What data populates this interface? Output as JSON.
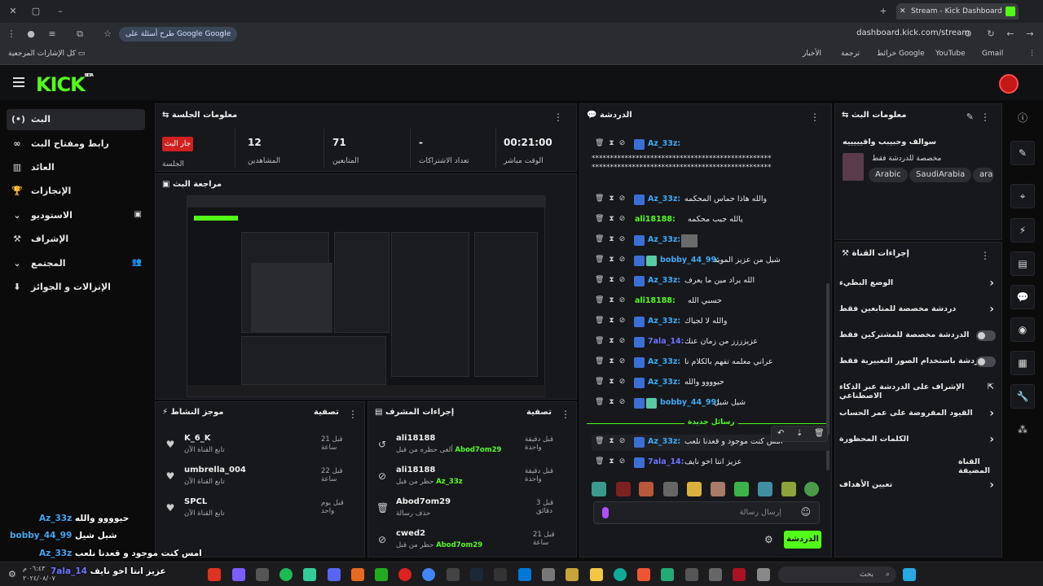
{
  "browser": {
    "tab_title": "Stream - Kick Dashboard",
    "url": "dashboard.kick.com/stream",
    "search_pill": "طرح أسئلة على Google",
    "bookmarks_all": "كل الإشارات المرجعية",
    "bookmarks": [
      "Gmail",
      "YouTube",
      "خرائط Google",
      "ترجمة",
      "الأخبار"
    ]
  },
  "header": {
    "logo": "KICK",
    "logo_sup": "BETA"
  },
  "sidebar": {
    "items": [
      {
        "label": "البث",
        "icon": "(•)"
      },
      {
        "label": "رابط ومفتاح البث",
        "icon": "∞"
      },
      {
        "label": "العائد",
        "icon": "▥"
      },
      {
        "label": "الإنجازات",
        "icon": "🏆"
      },
      {
        "label": "الاستوديو",
        "icon": "▣"
      },
      {
        "label": "الإشراف",
        "icon": "⚒"
      },
      {
        "label": "المجتمع",
        "icon": "👥"
      },
      {
        "label": "الإنزالات و الجوائز",
        "icon": "⬇"
      }
    ]
  },
  "session": {
    "title": "معلومات الجلسة",
    "live_badge": "جار البث",
    "session_label": "الجلسة",
    "stats": [
      {
        "value": "12",
        "label": "المشاهدين"
      },
      {
        "value": "71",
        "label": "المتابعين"
      },
      {
        "value": "-",
        "label": "تعداد الاشتراكات"
      },
      {
        "value": "00:21:00",
        "label": "الوقت مباشر"
      }
    ]
  },
  "preview": {
    "title": "مراجعة البث"
  },
  "activity": {
    "title": "موجز النشاط",
    "filter": "تصفية",
    "items": [
      {
        "name": "K_6_K",
        "sub": "تابع القناة الآن",
        "time": "قبل 21 ساعة"
      },
      {
        "name": "umbrella_004",
        "sub": "تابع القناة الآن",
        "time": "قبل 22 ساعة"
      },
      {
        "name": "SPCL",
        "sub": "تابع القناة الآن",
        "time": "قبل يوم واحد"
      }
    ]
  },
  "mod_actions": {
    "title": "إجراءات المشرف",
    "filter": "تصفية",
    "items": [
      {
        "name": "ali18188",
        "sub": "ألغى حظره من قبل",
        "by": "Abod7om29",
        "time": "قبل دقيقة واحدة"
      },
      {
        "name": "ali18188",
        "sub": "حظر من قبل",
        "by": "Az_33z",
        "time": "قبل دقيقة واحدة"
      },
      {
        "name": "Abod7om29",
        "sub": "حذف رسالة",
        "by": "",
        "time": "قبل 3 دقائق"
      },
      {
        "name": "cwed2",
        "sub": "حظر من قبل",
        "by": "Abod7om29",
        "time": "قبل 21 ساعة"
      }
    ]
  },
  "chat": {
    "title": "الدردشة",
    "new_messages": "رسائل جديدة",
    "input_placeholder": "إرسال رسالة",
    "send_label": "الدردشة",
    "colors": {
      "blue": "#3fa9f5",
      "green": "#53fc18",
      "teal": "#59c9a5",
      "purple": "#6b74ff"
    },
    "long_line": "*************************************************",
    "messages": [
      {
        "user": "Az_33z:",
        "msg": "",
        "color": "#3fa9f5",
        "badges": 1
      },
      {
        "user": "Az_33z:",
        "msg": "والله هاذا حماس المحكمه",
        "color": "#3fa9f5",
        "badges": 1
      },
      {
        "user": "ali18188:",
        "msg": "يالله جيب محكمه",
        "color": "#53fc18",
        "badges": 0
      },
      {
        "user": "Az_33z:",
        "msg": "",
        "color": "#3fa9f5",
        "badges": 1
      },
      {
        "user": "bobby_44_99:",
        "msg": "شيل من عزيز المويد",
        "color": "#3fa9f5",
        "badges": 2
      },
      {
        "user": "Az_33z:",
        "msg": "الله يراد مين ما يعرف",
        "color": "#3fa9f5",
        "badges": 1
      },
      {
        "user": "ali18188:",
        "msg": "حسبي الله",
        "color": "#53fc18",
        "badges": 0
      },
      {
        "user": "Az_33z:",
        "msg": "والله لا لجياك",
        "color": "#3fa9f5",
        "badges": 1
      },
      {
        "user": "7ala_14:",
        "msg": "عزيزززز من زمان عنك",
        "color": "#6b74ff",
        "badges": 1
      },
      {
        "user": "Az_33z:",
        "msg": "عراني معلمه تفهم بالكلام نا",
        "color": "#3fa9f5",
        "badges": 1
      },
      {
        "user": "Az_33z:",
        "msg": "حيوووو والله",
        "color": "#3fa9f5",
        "badges": 1
      },
      {
        "user": "bobby_44_99:",
        "msg": "شيل شيل",
        "color": "#3fa9f5",
        "badges": 2
      },
      {
        "user": "Az_33z:",
        "msg": "امس كنت موجود و قعدنا نلعب",
        "color": "#3fa9f5",
        "badges": 1
      },
      {
        "user": "7ala_14:",
        "msg": "عزيز انتا اخو نايف",
        "color": "#6b74ff",
        "badges": 1
      }
    ]
  },
  "stream_info": {
    "title": "معلومات البث",
    "stream_title": "سوالف وحبيبب واقيييييه",
    "category": "مخصصة للدردشة فقط",
    "tags": [
      "Arabic",
      "SaudiArabia",
      "ara"
    ]
  },
  "channel_actions": {
    "title": "إجراءات القناة",
    "items": [
      {
        "label": "الوضع البطيء",
        "type": "chevron"
      },
      {
        "label": "دردشة مخصصة للمتابعين فقط",
        "type": "chevron"
      },
      {
        "label": "الدردشة مخصصة للمشتركين فقط",
        "type": "toggle"
      },
      {
        "label": "الدردشة باستخدام الصور التعبيرية فقط",
        "type": "toggle"
      },
      {
        "label": "الإشراف على الدردشة عبر الذكاء الاصطناعي",
        "type": "link"
      },
      {
        "label": "القيود المفروضة على عمر الحساب",
        "type": "chevron"
      },
      {
        "label": "الكلمات المحظورة",
        "type": "chevron"
      },
      {
        "label": "القناة المضيفة",
        "type": "none"
      },
      {
        "label": "تعيين الأهداف",
        "type": "chevron"
      }
    ]
  },
  "overlay_chat": [
    {
      "user": "Az_33z",
      "msg": "حيوووو والله"
    },
    {
      "user": "bobby_44_99",
      "msg": "شيل شيل"
    },
    {
      "user": "Az_33z",
      "msg": "امس كنت موجود و قعدنا نلعب"
    },
    {
      "user": "7ala_14",
      "msg": "عزيز انتا اخو نايف"
    }
  ],
  "taskbar": {
    "search": "بحث",
    "time": "٠٦:٤٣ م",
    "date": "٢٠٢٤/٠٨/٠٧"
  }
}
